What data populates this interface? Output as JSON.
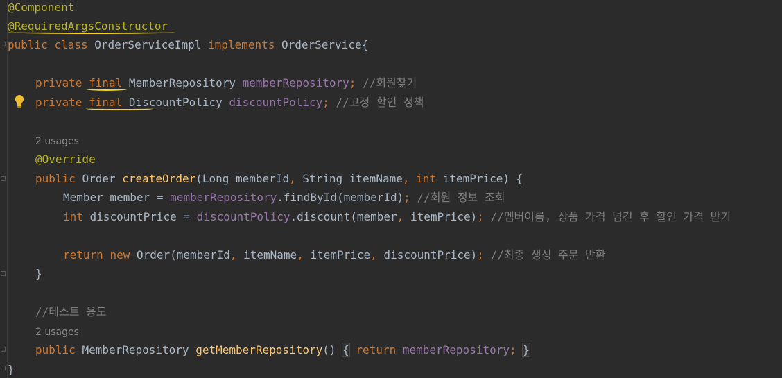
{
  "editor": {
    "lines": {
      "l1": {
        "ann": "@Component"
      },
      "l2": {
        "ann": "@RequiredArgsConstructor"
      },
      "l3": {
        "kw1": "public",
        "kw2": "class",
        "name": "OrderServiceImpl",
        "kw3": "implements",
        "iface": "OrderService{"
      },
      "l4": {
        "kw1": "private",
        "kw2": "final",
        "type": "MemberRepository",
        "field": "memberRepository",
        "semi": ";",
        "comment": "//회원찾기"
      },
      "l5": {
        "kw1": "private",
        "kw2": "final",
        "type": "DiscountPolicy",
        "field": "discountPolicy",
        "semi": ";",
        "comment": "//고정 할인 정책"
      },
      "h1": "2 usages",
      "l6": {
        "ann": "@Override"
      },
      "l7": {
        "kw1": "public",
        "type": "Order",
        "method": "createOrder",
        "p1": "(Long memberId",
        "c1": ",",
        "p2": " String itemName",
        "c2": ",",
        "kw2": "int",
        "p3": " itemPrice) {"
      },
      "l8": {
        "pre": "Member member = ",
        "field": "memberRepository",
        "post": ".findById(memberId)",
        "semi": ";",
        "comment": "//회원 정보 조회"
      },
      "l9": {
        "kw": "int",
        "pre": " discountPrice = ",
        "field": "discountPolicy",
        "post": ".discount(member",
        "c1": ",",
        "post2": " itemPrice)",
        "semi": ";",
        "comment": "//멤버이름, 상품 가격 넘긴 후 할인 가격 받기"
      },
      "l10": {
        "kw1": "return",
        "kw2": "new",
        "pre": "Order(memberId",
        "c1": ",",
        "a2": " itemName",
        "c2": ",",
        "a3": " itemPrice",
        "c3": ",",
        "a4": " discountPrice)",
        "semi": ";",
        "comment": "//최종 생성 주문 반환"
      },
      "l11": "}",
      "l12": {
        "comment": "//테스트 용도"
      },
      "h2": "2 usages",
      "l13": {
        "kw1": "public",
        "type": "MemberRepository",
        "method": "getMemberRepository",
        "paren": "()",
        "ob": "{",
        "kw2": "return",
        "field": "memberRepository",
        "semi": ";",
        "cb": "}"
      },
      "l14": "}"
    }
  },
  "colors": {
    "background": "#2b2b2b",
    "keyword": "#cc7832",
    "annotation": "#bbb529",
    "field": "#9876aa",
    "method": "#ffc66d",
    "comment": "#808080",
    "text": "#a9b7c6",
    "underline": "#f5d90a"
  },
  "icons": {
    "gutter_bulb": "lightbulb-icon"
  }
}
